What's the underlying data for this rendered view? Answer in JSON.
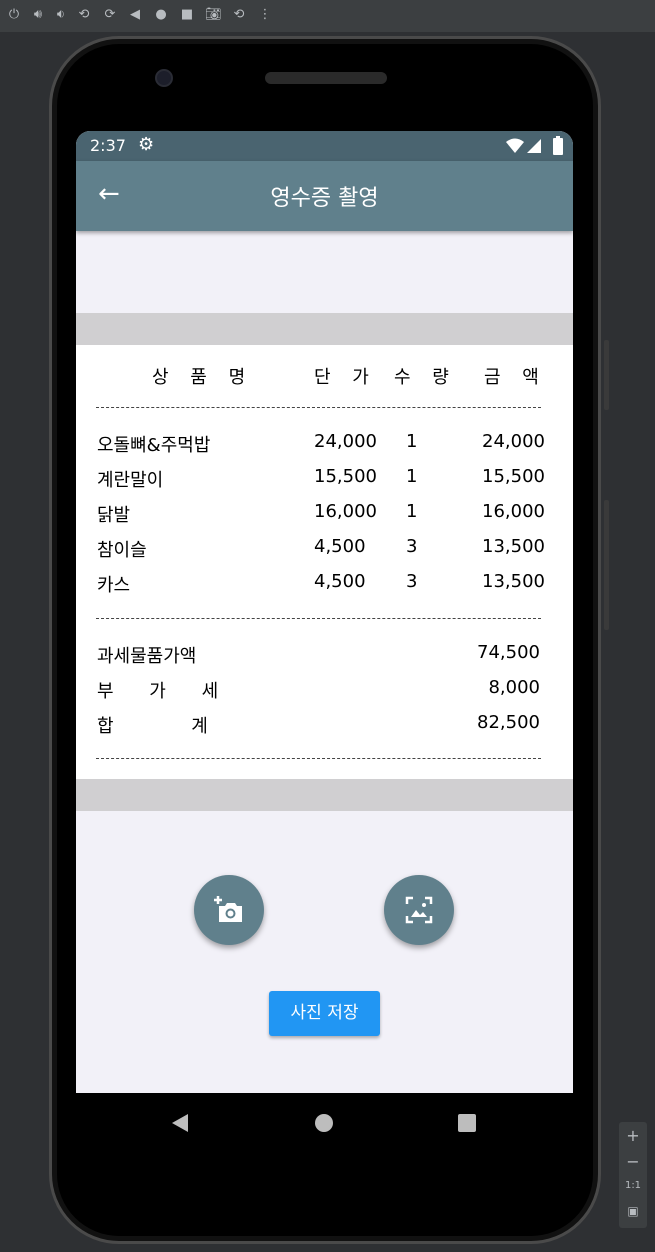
{
  "statusbar": {
    "time": "2:37"
  },
  "appbar": {
    "title": "영수증 촬영"
  },
  "receipt": {
    "headers": {
      "name": "상 품 명",
      "price": "단 가",
      "qty": "수 량",
      "amount": "금 액"
    },
    "items": [
      {
        "name": "오돌뼈&주먹밥",
        "price": "24,000",
        "qty": "1",
        "amount": "24,000"
      },
      {
        "name": "계란말이",
        "price": "15,500",
        "qty": "1",
        "amount": "15,500"
      },
      {
        "name": "닭발",
        "price": "16,000",
        "qty": "1",
        "amount": "16,000"
      },
      {
        "name": "참이슬",
        "price": "4,500",
        "qty": "3",
        "amount": "13,500"
      },
      {
        "name": "카스",
        "price": "4,500",
        "qty": "3",
        "amount": "13,500"
      }
    ],
    "summary": [
      {
        "label": "과세물품가액",
        "value": "74,500"
      },
      {
        "label": "부 가 세",
        "value": "8,000"
      },
      {
        "label": "합 계",
        "value": "82,500"
      }
    ]
  },
  "buttons": {
    "camera_icon": "add-photo-camera-icon",
    "gallery_icon": "image-gallery-icon",
    "save_label": "사진 저장"
  },
  "emulator": {
    "zoom_label": "1:1"
  }
}
